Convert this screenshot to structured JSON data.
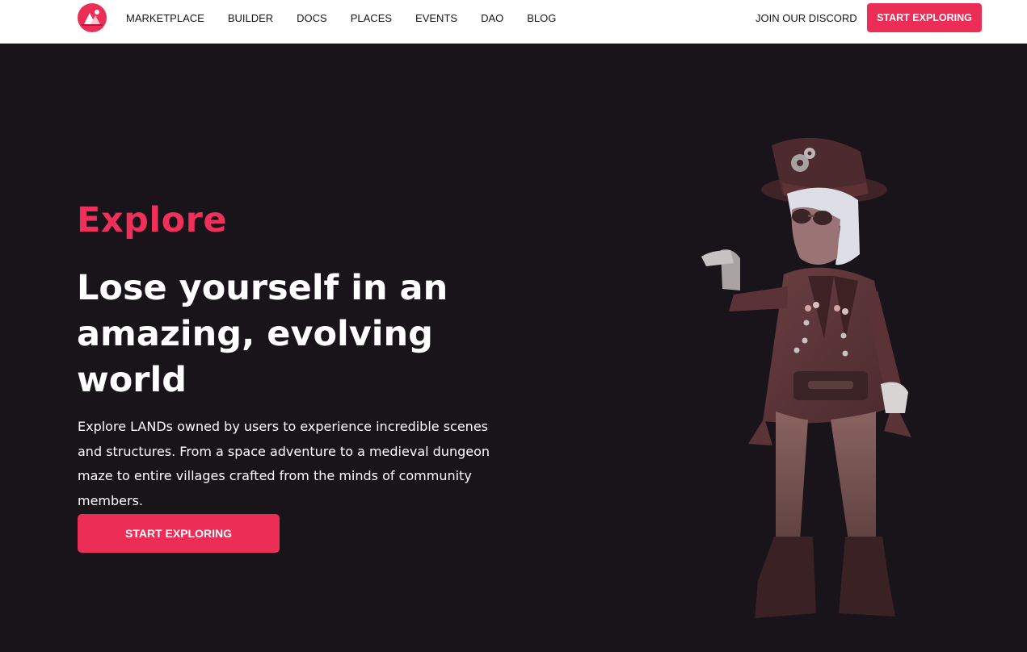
{
  "nav": {
    "links": [
      {
        "label": "MARKETPLACE"
      },
      {
        "label": "BUILDER"
      },
      {
        "label": "DOCS"
      },
      {
        "label": "PLACES"
      },
      {
        "label": "EVENTS"
      },
      {
        "label": "DAO"
      },
      {
        "label": "BLOG"
      }
    ],
    "discord_label": "JOIN OUR DISCORD",
    "cta_label": "START EXPLORING"
  },
  "hero": {
    "eyebrow": "Explore",
    "headline": "Lose yourself in an amazing, evolving world",
    "description": "Explore LANDs owned by users to experience incredible scenes and structures. From a space adventure to a medieval dungeon maze to entire villages crafted from the minds of community members.",
    "cta_label": "START EXPLORING"
  },
  "icons": {
    "logo": "decentraland-logo-icon",
    "avatar": "steampunk-avatar-illustration"
  },
  "colors": {
    "accent": "#ec2d55",
    "accent_text": "#f0305a",
    "hero_background": "#18141a",
    "nav_background": "#ffffff",
    "nav_text": "#16141a"
  }
}
